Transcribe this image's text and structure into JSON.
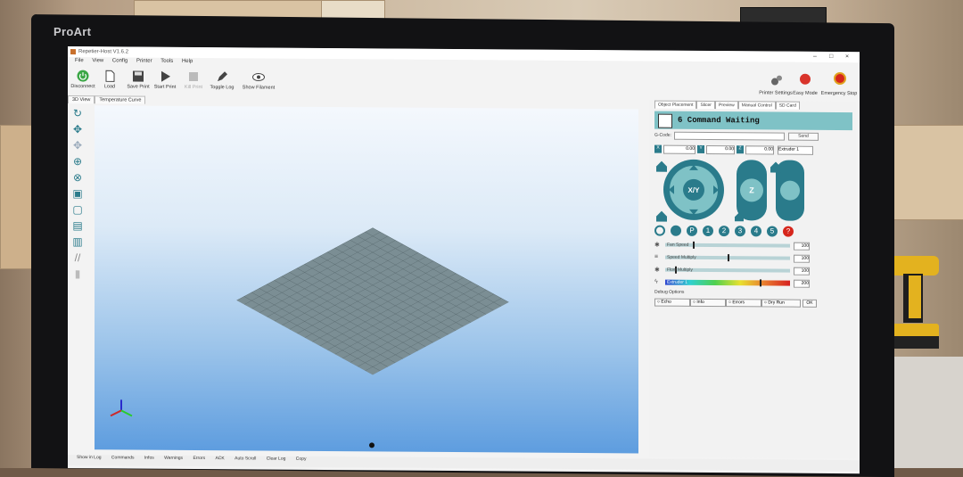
{
  "monitor": {
    "brand": "ProArt"
  },
  "app": {
    "title": "Repetier-Host V1.6.2",
    "window_controls": [
      "–",
      "□",
      "×"
    ]
  },
  "menu": [
    "File",
    "View",
    "Config",
    "Printer",
    "Tools",
    "Help"
  ],
  "toolbar": [
    {
      "label": "Disconnect",
      "icon": "power-icon"
    },
    {
      "label": "Load",
      "icon": "file-icon"
    },
    {
      "label": "Save Print",
      "icon": "save-icon"
    },
    {
      "label": "Start Print",
      "icon": "play-icon"
    },
    {
      "label": "Kill Print",
      "icon": "stop-icon"
    },
    {
      "label": "Toggle Log",
      "icon": "pencil-icon"
    },
    {
      "label": "Show Filament",
      "icon": "eye-icon"
    }
  ],
  "toolbar_right": [
    {
      "label": "Printer Settings",
      "icon": "gear-icon"
    },
    {
      "label": "Easy Mode",
      "icon": "easy-mode-icon"
    },
    {
      "label": "Emergency Stop",
      "icon": "emergency-stop-icon"
    }
  ],
  "view_tabs": [
    "3D View",
    "Temperature Curve"
  ],
  "right_tabs": [
    "Object Placement",
    "Slicer",
    "Preview",
    "Manual Control",
    "SD Card"
  ],
  "manual": {
    "status": "6 Command Waiting",
    "gcode_label": "G-Code:",
    "send_label": "Send",
    "x_label": "X",
    "x_value": "0.00",
    "y_label": "Y",
    "y_value": "0.00",
    "z_label": "Z",
    "z_value": "0.00",
    "extruder_select": "Extruder 1",
    "xy_label": "X/Y",
    "z_pad_label": "Z",
    "fans": [
      "1",
      "2",
      "3",
      "4",
      "5"
    ],
    "sliders": [
      {
        "label": "Fan Speed",
        "value": "100",
        "level": 0.22
      },
      {
        "label": "Speed Multiply",
        "value": "100",
        "level": 0.5
      },
      {
        "label": "Flow Multiply",
        "value": "100",
        "level": 0.08
      }
    ],
    "temp": {
      "label": "Extruder 1",
      "value": "200",
      "level": 0.76
    },
    "debug_label": "Debug Options",
    "debug_options": [
      "Echo",
      "Info",
      "Errors",
      "Dry Run"
    ],
    "ok_label": "OK"
  },
  "statusbar": [
    "Show in Log",
    "Commands",
    "Infos",
    "Warnings",
    "Errors",
    "ACK",
    "Auto Scroll",
    "Clear Log",
    "Copy"
  ],
  "colors": {
    "accent": "#2a7b8b",
    "panel_header": "#7fc2c6",
    "bed": "#7b8e94"
  }
}
